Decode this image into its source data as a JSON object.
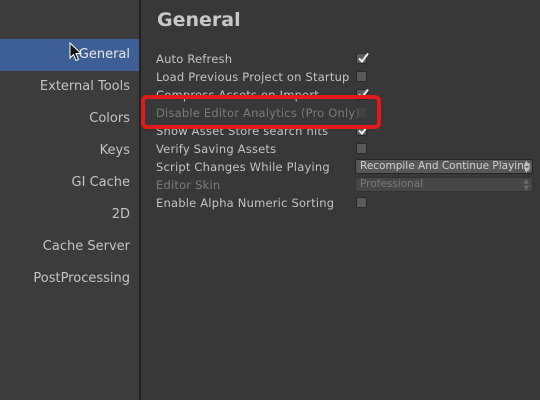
{
  "sidebar": {
    "items": [
      {
        "label": "General"
      },
      {
        "label": "External Tools"
      },
      {
        "label": "Colors"
      },
      {
        "label": "Keys"
      },
      {
        "label": "GI Cache"
      },
      {
        "label": "2D"
      },
      {
        "label": "Cache Server"
      },
      {
        "label": "PostProcessing"
      }
    ]
  },
  "main": {
    "title": "General",
    "settings": [
      {
        "label": "Auto Refresh",
        "checked": true
      },
      {
        "label": "Load Previous Project on Startup",
        "checked": false
      },
      {
        "label": "Compress Assets on Import",
        "checked": true
      },
      {
        "label": "Disable Editor Analytics (Pro Only)",
        "checked": false,
        "disabled": true
      },
      {
        "label": "Show Asset Store search hits",
        "checked": true
      },
      {
        "label": "Verify Saving Assets",
        "checked": false
      },
      {
        "label": "Script Changes While Playing",
        "value": "Recompile And Continue Playing"
      },
      {
        "label": "Editor Skin",
        "value": "Professional",
        "disabled": true
      },
      {
        "label": "Enable Alpha Numeric Sorting",
        "checked": false
      }
    ]
  },
  "colors": {
    "selected_bg": "#3e5f96",
    "highlight": "#e11a1a"
  }
}
